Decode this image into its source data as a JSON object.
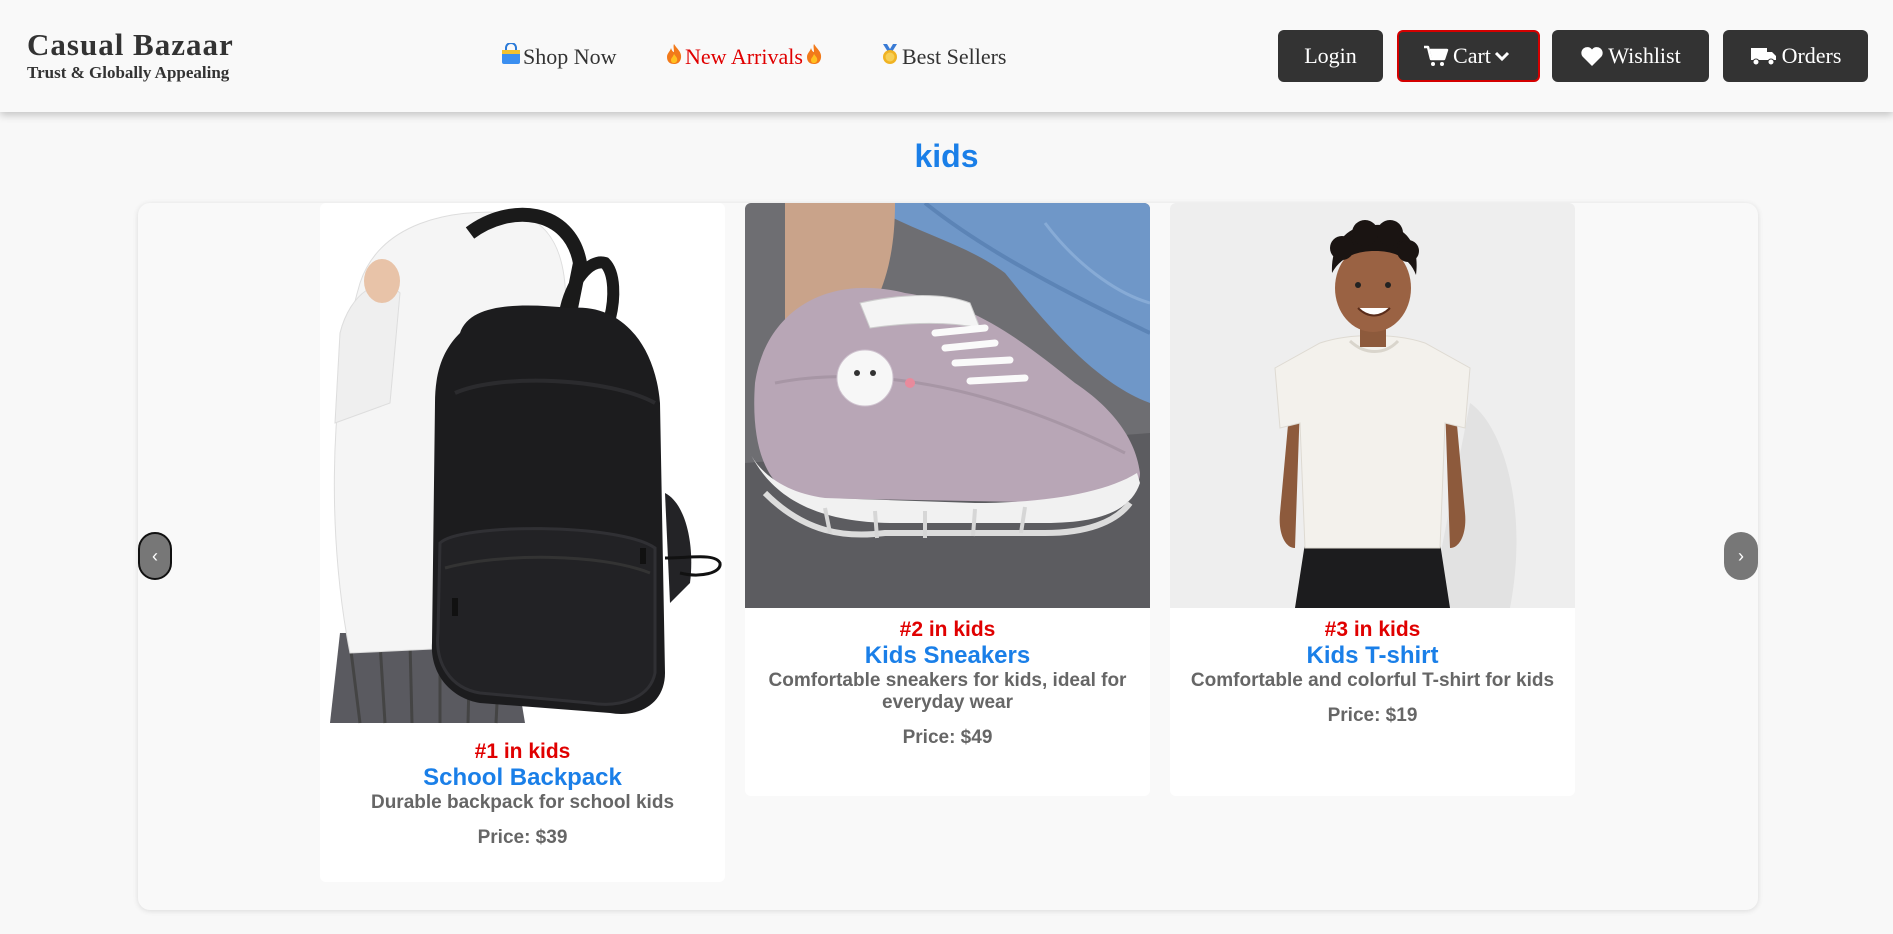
{
  "brand": {
    "name": "Casual Bazaar",
    "tagline": "Trust & Globally Appealing"
  },
  "nav": {
    "shop_now": "Shop Now",
    "new_arrivals": "New Arrivals",
    "best_sellers": "Best Sellers"
  },
  "actions": {
    "login": "Login",
    "cart": "Cart",
    "wishlist": "Wishlist",
    "orders": "Orders"
  },
  "section": {
    "title": "kids"
  },
  "carousel": {
    "prev": "‹",
    "next": "›"
  },
  "products": [
    {
      "rank": "#1 in kids",
      "name": "School Backpack",
      "description": "Durable backpack for school kids",
      "price": "Price: $39"
    },
    {
      "rank": "#2 in kids",
      "name": "Kids Sneakers",
      "description": "Comfortable sneakers for kids, ideal for everyday wear",
      "price": "Price: $49"
    },
    {
      "rank": "#3 in kids",
      "name": "Kids T-shirt",
      "description": "Comfortable and colorful T-shirt for kids",
      "price": "Price: $19"
    }
  ],
  "colors": {
    "accent": "#1a7fe8",
    "rank": "#e00000",
    "button": "#333333",
    "cart_border": "#d40000"
  },
  "icons": [
    "shopping-bag-icon",
    "fire-icon",
    "medal-icon",
    "shopping-cart-icon",
    "chevron-down-icon",
    "heart-icon",
    "truck-icon"
  ]
}
